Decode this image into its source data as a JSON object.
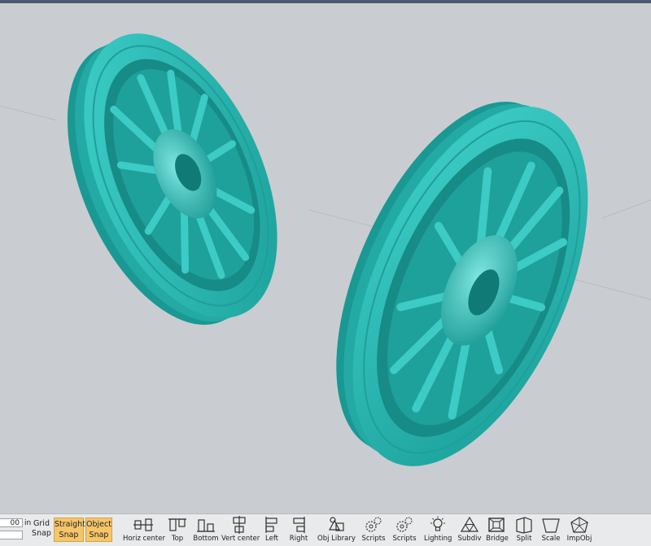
{
  "colors": {
    "model": "#2ab8b4",
    "background": "#c9cdd1",
    "snap_active": "#f5c56a"
  },
  "grid": {
    "value": "00",
    "unit": "in"
  },
  "snaps": {
    "grid": {
      "line1": "Grid",
      "line2": "Snap"
    },
    "straight": {
      "line1": "Straight",
      "line2": "Snap"
    },
    "object": {
      "line1": "Object",
      "line2": "Snap"
    }
  },
  "tools": [
    {
      "label": "Horiz center",
      "icon": "align-horiz-center-icon"
    },
    {
      "label": "Top",
      "icon": "align-top-icon"
    },
    {
      "label": "Bottom",
      "icon": "align-bottom-icon"
    },
    {
      "label": "Vert center",
      "icon": "align-vert-center-icon"
    },
    {
      "label": "Left",
      "icon": "align-left-icon"
    },
    {
      "label": "Right",
      "icon": "align-right-icon"
    },
    {
      "label": "Obj Library",
      "icon": "object-library-icon"
    },
    {
      "label": "Scripts",
      "icon": "scripts-gear-icon"
    },
    {
      "label": "Scripts",
      "icon": "scripts-gear-icon"
    },
    {
      "label": "Lighting",
      "icon": "lighting-bulb-icon"
    },
    {
      "label": "Subdiv",
      "icon": "subdiv-icon"
    },
    {
      "label": "Bridge",
      "icon": "bridge-icon"
    },
    {
      "label": "Split",
      "icon": "split-icon"
    },
    {
      "label": "Scale",
      "icon": "scale-icon"
    },
    {
      "label": "ImpObj",
      "icon": "import-object-icon"
    }
  ]
}
